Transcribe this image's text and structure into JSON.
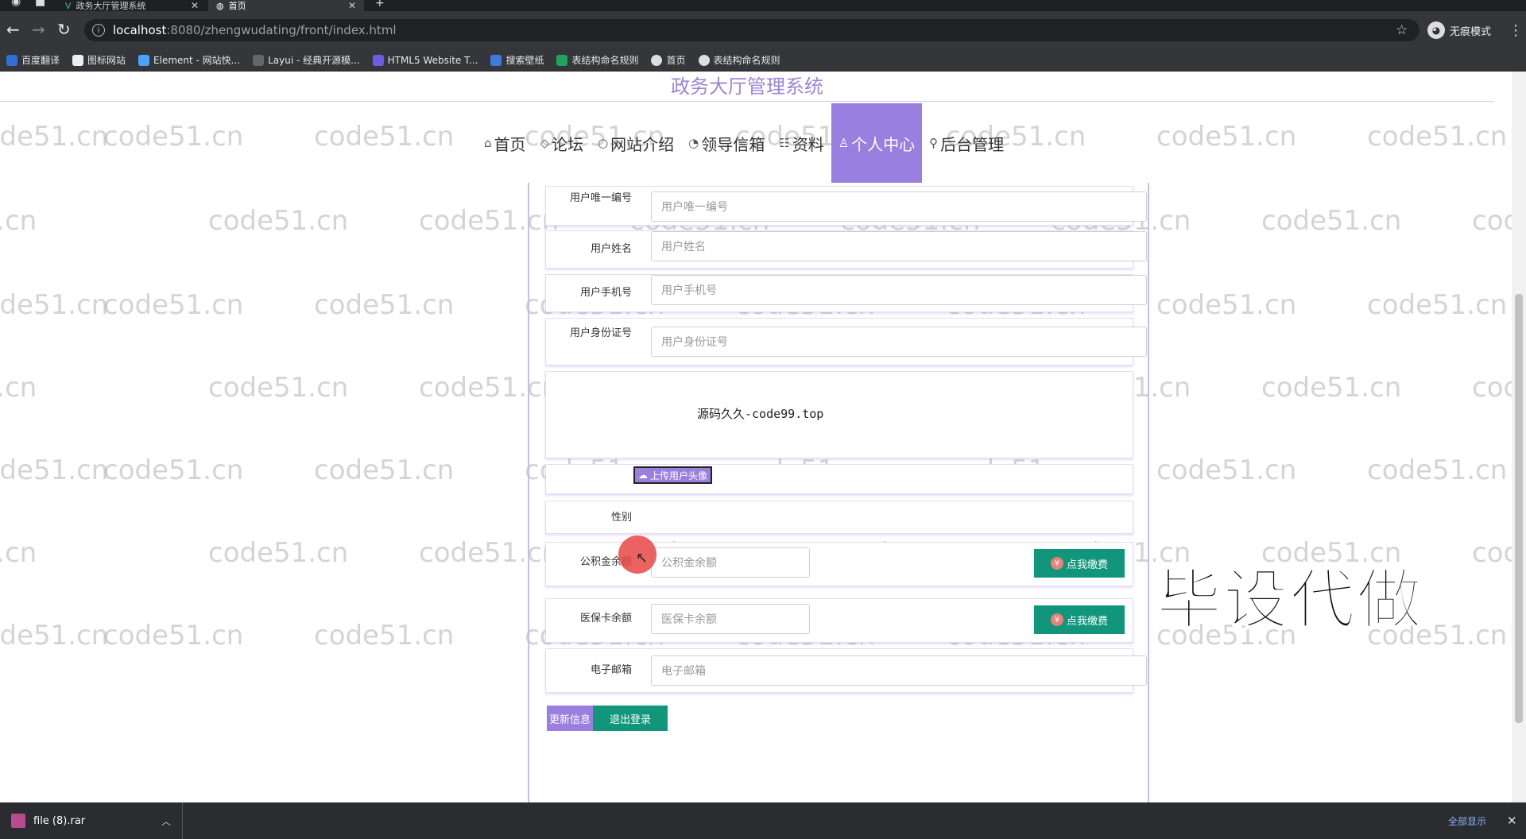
{
  "browser": {
    "tabs": [
      {
        "label": "政务大厅管理系统",
        "active": false
      },
      {
        "label": "首页",
        "active": true
      }
    ],
    "url_host": "localhost",
    "url_path": ":8080/zhengwudating/front/index.html",
    "profile_label": "无痕模式",
    "bookmarks": [
      "百度翻译",
      "图标网站",
      "Element - 网站快...",
      "Layui - 经典开源模...",
      "HTML5 Website T...",
      "搜索壁纸",
      "表结构命名规则",
      "首页",
      "表结构命名规则"
    ]
  },
  "page": {
    "title": "政务大厅管理系统",
    "watermark": "code51.cn",
    "nav": [
      {
        "label": "首页",
        "icon": "home-icon",
        "active": false
      },
      {
        "label": "论坛",
        "icon": "tag-icon",
        "active": false
      },
      {
        "label": "网站介绍",
        "icon": "circle-icon",
        "active": false
      },
      {
        "label": "领导信箱",
        "icon": "gauge-icon",
        "active": false
      },
      {
        "label": "资料",
        "icon": "list-icon",
        "active": false
      },
      {
        "label": "个人中心",
        "icon": "user-icon",
        "active": true
      },
      {
        "label": "后台管理",
        "icon": "link-icon",
        "active": false
      }
    ],
    "form": {
      "user_id_label": "用户唯一编号",
      "user_id_placeholder": "用户唯一编号",
      "name_label": "用户姓名",
      "name_placeholder": "用户姓名",
      "phone_label": "用户手机号",
      "phone_placeholder": "用户手机号",
      "idcard_label": "用户身份证号",
      "idcard_placeholder": "用户身份证号",
      "avatar_text": "源码久久-code99.top",
      "upload_label": "上传用户头像",
      "gender_label": "性别",
      "fund_label": "公积金余额",
      "fund_placeholder": "公积金余额",
      "fund_pay": "点我缴费",
      "medical_label": "医保卡余额",
      "medical_placeholder": "医保卡余额",
      "medical_pay": "点我缴费",
      "email_label": "电子邮箱",
      "email_placeholder": "电子邮箱",
      "update_btn": "更新信息",
      "logout_btn": "退出登录"
    },
    "overlay_text": "毕设代做"
  },
  "download_bar": {
    "file_name": "file (8).rar",
    "show_all": "全部显示"
  },
  "colors": {
    "accent": "#9b7fe0",
    "pay_button": "#11967c",
    "title": "#9b86d6"
  }
}
